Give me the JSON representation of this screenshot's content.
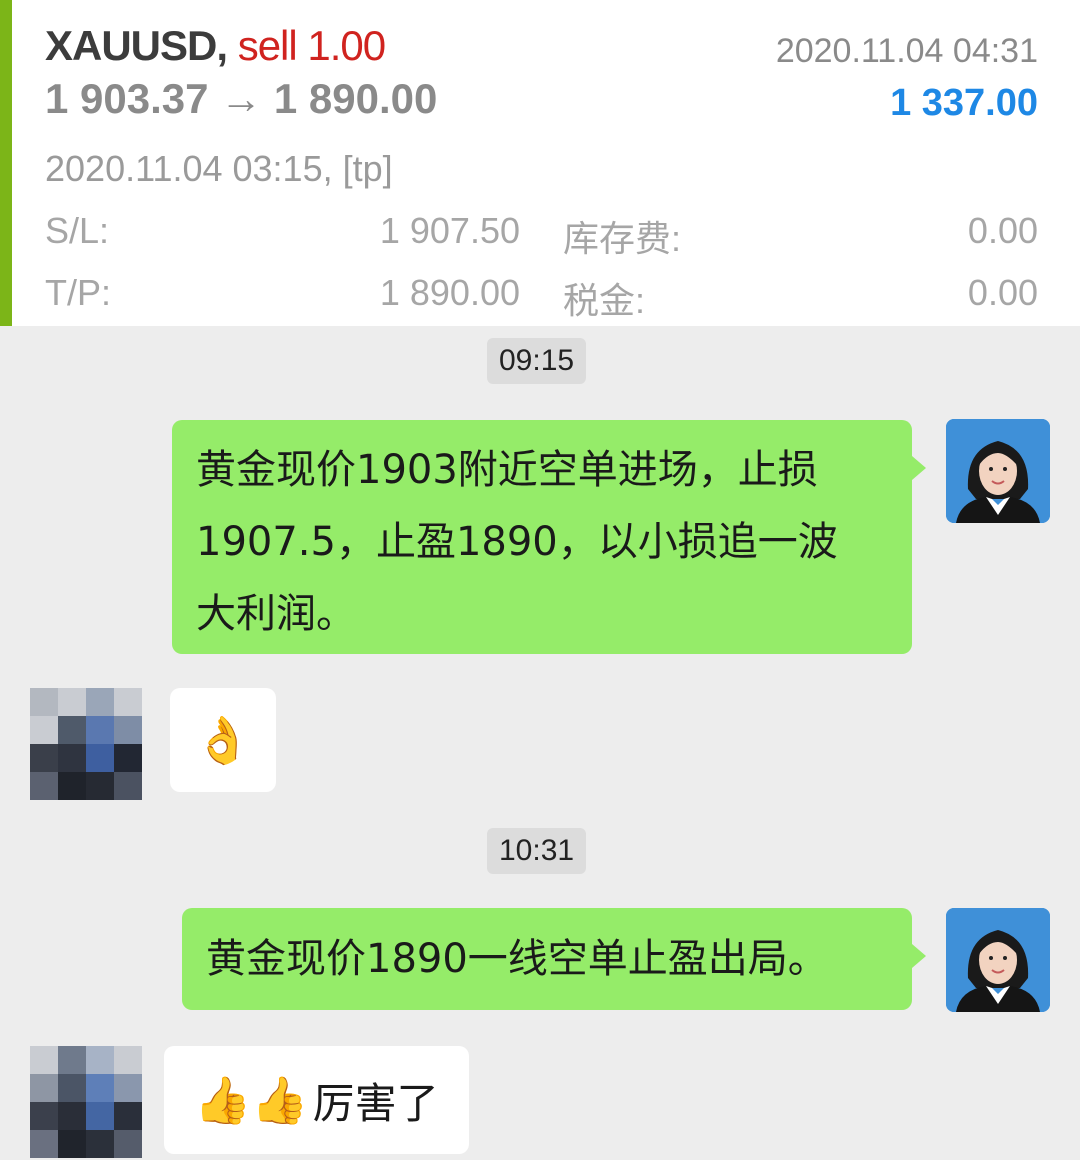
{
  "trade": {
    "symbol": "XAUUSD",
    "separator": ",",
    "side": "sell",
    "volume": "1.00",
    "open_price": "1 903.37",
    "arrow": "→",
    "close_price": "1 890.00",
    "close_time": "2020.11.04 04:31",
    "profit": "1 337.00",
    "open_info": "2020.11.04 03:15, [tp]",
    "sl_label": "S/L:",
    "sl_value": "1 907.50",
    "tp_label": "T/P:",
    "tp_value": "1 890.00",
    "swap_label": "库存费:",
    "swap_value": "0.00",
    "tax_label": "税金:",
    "tax_value": "0.00",
    "accent_color": "#7cb518",
    "profit_color": "#1e88e5",
    "sell_color": "#d0231f"
  },
  "chat": {
    "time_1": "09:15",
    "msg_1_line_1": "黄金现价1903附近空单进场，止损",
    "msg_1_line_2": "1907.5，止盈1890，以小损追一波",
    "msg_1_line_3": "大利润。",
    "reply_1_emoji": "👌",
    "time_2": "10:31",
    "msg_2": "黄金现价1890一线空单止盈出局。",
    "reply_2_emoji_1": "👍",
    "reply_2_emoji_2": "👍",
    "reply_2_text": "厉害了",
    "bubble_green": "#95ec69",
    "background": "#ededed"
  }
}
